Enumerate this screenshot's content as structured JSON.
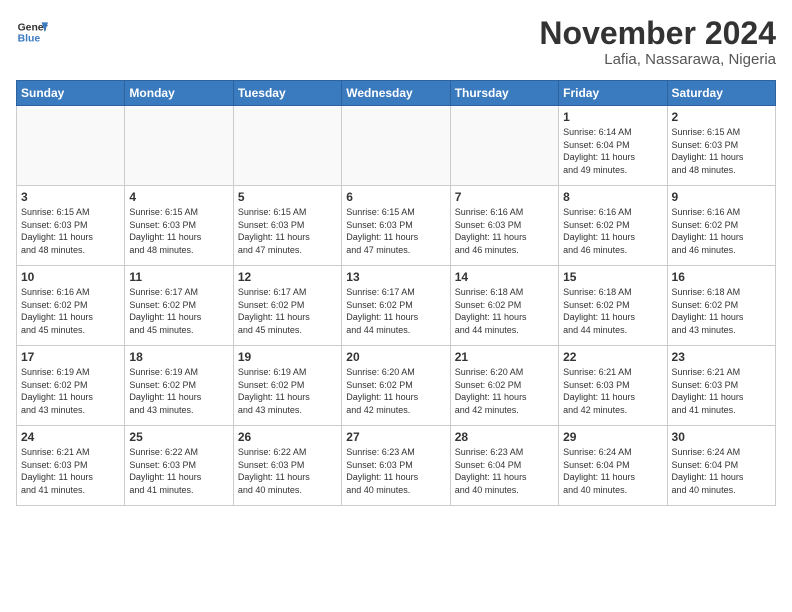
{
  "header": {
    "logo_line1": "General",
    "logo_line2": "Blue",
    "month": "November 2024",
    "location": "Lafia, Nassarawa, Nigeria"
  },
  "weekdays": [
    "Sunday",
    "Monday",
    "Tuesday",
    "Wednesday",
    "Thursday",
    "Friday",
    "Saturday"
  ],
  "weeks": [
    [
      {
        "day": "",
        "info": ""
      },
      {
        "day": "",
        "info": ""
      },
      {
        "day": "",
        "info": ""
      },
      {
        "day": "",
        "info": ""
      },
      {
        "day": "",
        "info": ""
      },
      {
        "day": "1",
        "info": "Sunrise: 6:14 AM\nSunset: 6:04 PM\nDaylight: 11 hours\nand 49 minutes."
      },
      {
        "day": "2",
        "info": "Sunrise: 6:15 AM\nSunset: 6:03 PM\nDaylight: 11 hours\nand 48 minutes."
      }
    ],
    [
      {
        "day": "3",
        "info": "Sunrise: 6:15 AM\nSunset: 6:03 PM\nDaylight: 11 hours\nand 48 minutes."
      },
      {
        "day": "4",
        "info": "Sunrise: 6:15 AM\nSunset: 6:03 PM\nDaylight: 11 hours\nand 48 minutes."
      },
      {
        "day": "5",
        "info": "Sunrise: 6:15 AM\nSunset: 6:03 PM\nDaylight: 11 hours\nand 47 minutes."
      },
      {
        "day": "6",
        "info": "Sunrise: 6:15 AM\nSunset: 6:03 PM\nDaylight: 11 hours\nand 47 minutes."
      },
      {
        "day": "7",
        "info": "Sunrise: 6:16 AM\nSunset: 6:03 PM\nDaylight: 11 hours\nand 46 minutes."
      },
      {
        "day": "8",
        "info": "Sunrise: 6:16 AM\nSunset: 6:02 PM\nDaylight: 11 hours\nand 46 minutes."
      },
      {
        "day": "9",
        "info": "Sunrise: 6:16 AM\nSunset: 6:02 PM\nDaylight: 11 hours\nand 46 minutes."
      }
    ],
    [
      {
        "day": "10",
        "info": "Sunrise: 6:16 AM\nSunset: 6:02 PM\nDaylight: 11 hours\nand 45 minutes."
      },
      {
        "day": "11",
        "info": "Sunrise: 6:17 AM\nSunset: 6:02 PM\nDaylight: 11 hours\nand 45 minutes."
      },
      {
        "day": "12",
        "info": "Sunrise: 6:17 AM\nSunset: 6:02 PM\nDaylight: 11 hours\nand 45 minutes."
      },
      {
        "day": "13",
        "info": "Sunrise: 6:17 AM\nSunset: 6:02 PM\nDaylight: 11 hours\nand 44 minutes."
      },
      {
        "day": "14",
        "info": "Sunrise: 6:18 AM\nSunset: 6:02 PM\nDaylight: 11 hours\nand 44 minutes."
      },
      {
        "day": "15",
        "info": "Sunrise: 6:18 AM\nSunset: 6:02 PM\nDaylight: 11 hours\nand 44 minutes."
      },
      {
        "day": "16",
        "info": "Sunrise: 6:18 AM\nSunset: 6:02 PM\nDaylight: 11 hours\nand 43 minutes."
      }
    ],
    [
      {
        "day": "17",
        "info": "Sunrise: 6:19 AM\nSunset: 6:02 PM\nDaylight: 11 hours\nand 43 minutes."
      },
      {
        "day": "18",
        "info": "Sunrise: 6:19 AM\nSunset: 6:02 PM\nDaylight: 11 hours\nand 43 minutes."
      },
      {
        "day": "19",
        "info": "Sunrise: 6:19 AM\nSunset: 6:02 PM\nDaylight: 11 hours\nand 43 minutes."
      },
      {
        "day": "20",
        "info": "Sunrise: 6:20 AM\nSunset: 6:02 PM\nDaylight: 11 hours\nand 42 minutes."
      },
      {
        "day": "21",
        "info": "Sunrise: 6:20 AM\nSunset: 6:02 PM\nDaylight: 11 hours\nand 42 minutes."
      },
      {
        "day": "22",
        "info": "Sunrise: 6:21 AM\nSunset: 6:03 PM\nDaylight: 11 hours\nand 42 minutes."
      },
      {
        "day": "23",
        "info": "Sunrise: 6:21 AM\nSunset: 6:03 PM\nDaylight: 11 hours\nand 41 minutes."
      }
    ],
    [
      {
        "day": "24",
        "info": "Sunrise: 6:21 AM\nSunset: 6:03 PM\nDaylight: 11 hours\nand 41 minutes."
      },
      {
        "day": "25",
        "info": "Sunrise: 6:22 AM\nSunset: 6:03 PM\nDaylight: 11 hours\nand 41 minutes."
      },
      {
        "day": "26",
        "info": "Sunrise: 6:22 AM\nSunset: 6:03 PM\nDaylight: 11 hours\nand 40 minutes."
      },
      {
        "day": "27",
        "info": "Sunrise: 6:23 AM\nSunset: 6:03 PM\nDaylight: 11 hours\nand 40 minutes."
      },
      {
        "day": "28",
        "info": "Sunrise: 6:23 AM\nSunset: 6:04 PM\nDaylight: 11 hours\nand 40 minutes."
      },
      {
        "day": "29",
        "info": "Sunrise: 6:24 AM\nSunset: 6:04 PM\nDaylight: 11 hours\nand 40 minutes."
      },
      {
        "day": "30",
        "info": "Sunrise: 6:24 AM\nSunset: 6:04 PM\nDaylight: 11 hours\nand 40 minutes."
      }
    ]
  ]
}
